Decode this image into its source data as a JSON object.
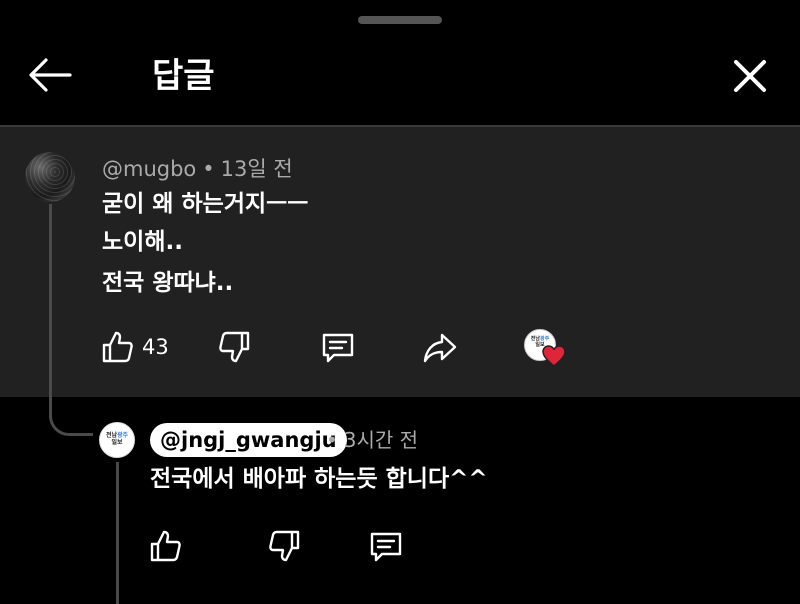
{
  "header": {
    "title": "답글"
  },
  "parent_comment": {
    "handle": "@mugbo",
    "separator": "•",
    "time": "13일 전",
    "lines": [
      "굳이 왜 하는거지ㅡㅡ",
      "노이해..",
      "전국 왕따냐.."
    ],
    "like_count": "43"
  },
  "reply": {
    "handle": "@jngj_gwangju",
    "separator": "•",
    "time": "3시간 전",
    "text": "전국에서 배아파 하는듯 합니다^^",
    "logo_top": "전남",
    "logo_accent": "광주",
    "logo_bottom": "일보"
  },
  "colors": {
    "background": "#000000",
    "comment_bg": "#212121",
    "meta_text": "#aaaaaa",
    "heart": "#e0243a"
  },
  "icons": [
    "back-arrow-icon",
    "close-icon",
    "thumbs-up-icon",
    "thumbs-down-icon",
    "comment-icon",
    "share-icon",
    "heart-icon"
  ]
}
